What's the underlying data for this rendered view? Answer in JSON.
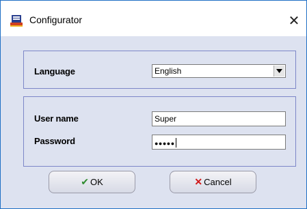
{
  "window": {
    "title": "Configurator"
  },
  "language": {
    "label": "Language",
    "selected": "English"
  },
  "login": {
    "username_label": "User name",
    "username_value": "Super",
    "password_label": "Password",
    "password_mask": "●●●●●"
  },
  "buttons": {
    "ok": "OK",
    "cancel": "Cancel"
  },
  "colors": {
    "check": "#2e8b2e",
    "cross": "#d01818",
    "border": "#7c86c8",
    "dialog_bg": "#dde2f0"
  }
}
